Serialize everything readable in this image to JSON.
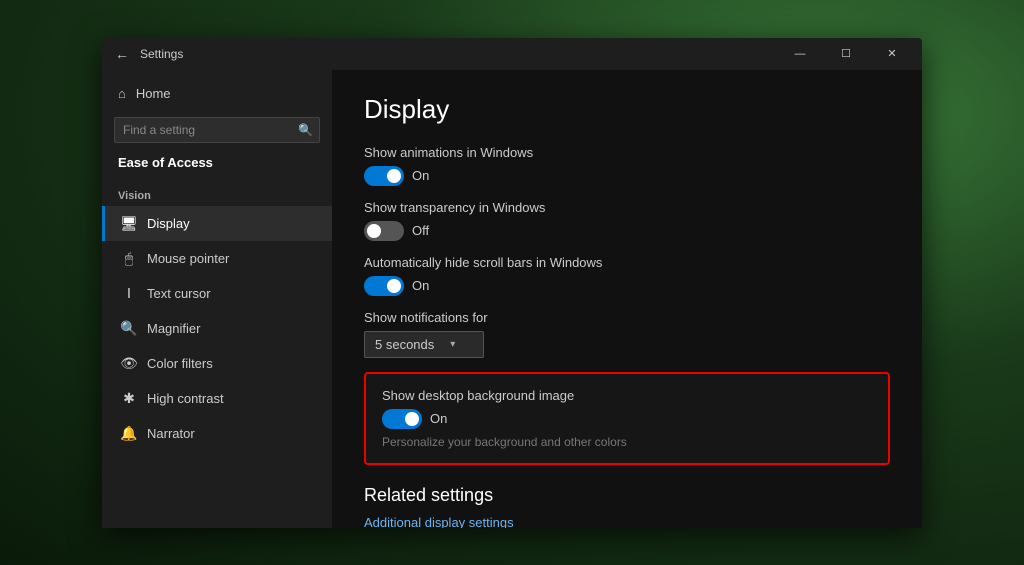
{
  "window": {
    "title": "Settings",
    "titlebar": {
      "back_label": "←",
      "title": "Settings",
      "minimize": "—",
      "maximize": "☐",
      "close": "✕"
    }
  },
  "sidebar": {
    "home_label": "Home",
    "search_placeholder": "Find a setting",
    "section_label": "Vision",
    "heading": "Ease of Access",
    "items": [
      {
        "id": "display",
        "label": "Display",
        "icon": "🖥"
      },
      {
        "id": "mouse-pointer",
        "label": "Mouse pointer",
        "icon": "🖱"
      },
      {
        "id": "text-cursor",
        "label": "Text cursor",
        "icon": "I"
      },
      {
        "id": "magnifier",
        "label": "Magnifier",
        "icon": "🔍"
      },
      {
        "id": "color-filters",
        "label": "Color filters",
        "icon": "👁"
      },
      {
        "id": "high-contrast",
        "label": "High contrast",
        "icon": "✱"
      },
      {
        "id": "narrator",
        "label": "Narrator",
        "icon": "🔔"
      }
    ]
  },
  "main": {
    "title": "Display",
    "settings": [
      {
        "id": "show-animations",
        "label": "Show animations in Windows",
        "toggle_state": "on",
        "toggle_text": "On"
      },
      {
        "id": "show-transparency",
        "label": "Show transparency in Windows",
        "toggle_state": "off",
        "toggle_text": "Off"
      },
      {
        "id": "hide-scrollbars",
        "label": "Automatically hide scroll bars in Windows",
        "toggle_state": "on",
        "toggle_text": "On"
      }
    ],
    "notifications_for_label": "Show notifications for",
    "notifications_value": "5 seconds",
    "highlight_section": {
      "label": "Show desktop background image",
      "toggle_state": "on",
      "toggle_text": "On",
      "sub_text": "Personalize your background and other colors"
    },
    "related": {
      "title": "Related settings",
      "link": "Additional display settings"
    }
  }
}
